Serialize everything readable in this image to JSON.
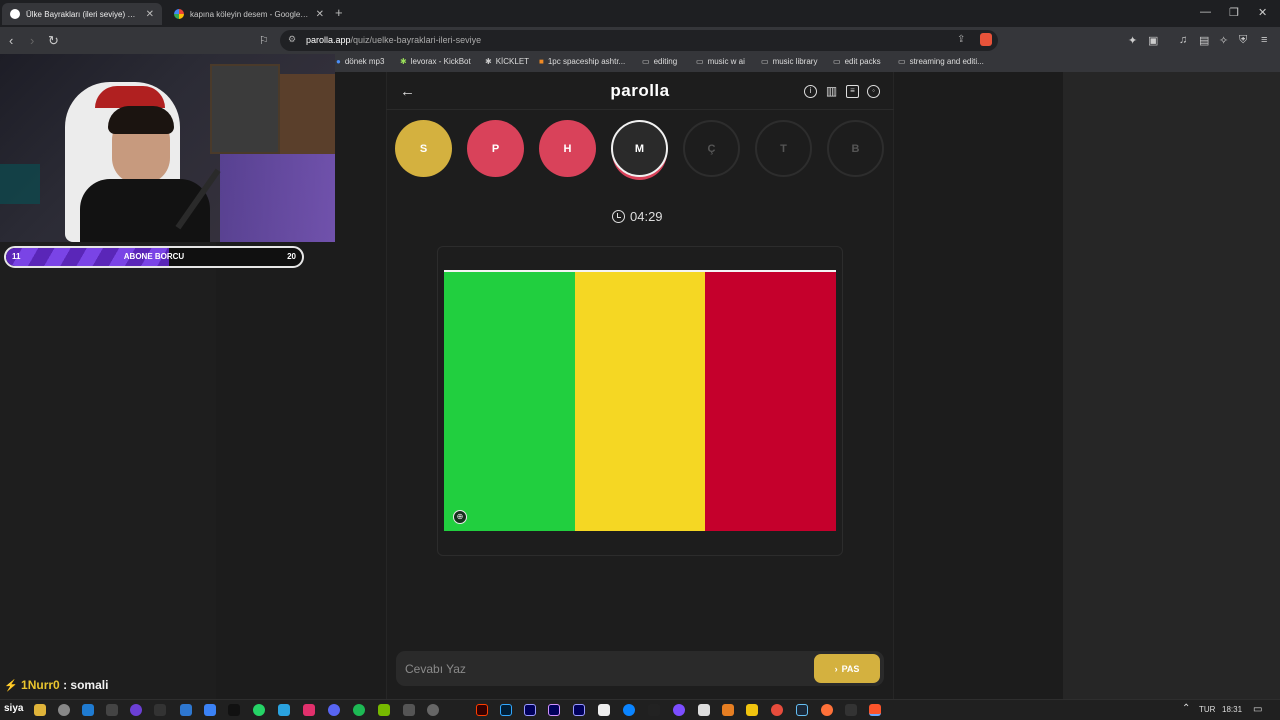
{
  "browser": {
    "tabs": [
      {
        "title": "Ülke Bayrakları (ileri seviye) quiz",
        "active": true
      },
      {
        "title": "kapına köleyin desem - Google'da Ar",
        "active": false
      }
    ],
    "url": {
      "domain": "parolla.app",
      "path": "/quiz/uelke-bayraklari-ileri-seviye"
    },
    "bookmarks": [
      "dönek mp3",
      "levorax - KickBot",
      "KİCKLET",
      "1pc spaceship ashtr...",
      "editing",
      "music w ai",
      "music library",
      "edit packs",
      "streaming and editi..."
    ]
  },
  "stream": {
    "abone_bar": {
      "left": "11",
      "label": "ABONE BORCU",
      "right": "20",
      "progress": 0.55
    },
    "chat": {
      "user": "1Nurr0",
      "message": ": somali"
    }
  },
  "app": {
    "logo": "parolla",
    "letters": [
      {
        "char": "S",
        "state": "yellow"
      },
      {
        "char": "P",
        "state": "red"
      },
      {
        "char": "H",
        "state": "red"
      },
      {
        "char": "M",
        "state": "current"
      },
      {
        "char": "Ç",
        "state": "empty"
      },
      {
        "char": "T",
        "state": "empty"
      },
      {
        "char": "B",
        "state": "empty"
      }
    ],
    "timer": "04:29",
    "flag_colors": [
      "#21cf3f",
      "#f5d723",
      "#c5002c"
    ],
    "answer": {
      "placeholder": "Cevabı Yaz",
      "pass_label": "PAS"
    }
  },
  "taskbar": {
    "start_label": "siya",
    "language": "TUR",
    "clock": "18:31"
  },
  "colors": {
    "accent_yellow": "#d4b13f",
    "accent_red": "#d9425a"
  }
}
